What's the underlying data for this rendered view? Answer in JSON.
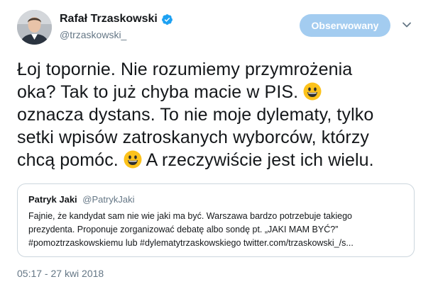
{
  "author": {
    "display_name": "Rafał Trzaskowski",
    "handle": "@trzaskowski_",
    "verified": true
  },
  "follow_button": {
    "label": "Obserwowany"
  },
  "tweet": {
    "line1": "Łoj topornie. Nie rozumiemy przymrożenia",
    "line2": "oka? Tak to już chyba macie w PIS.",
    "line3": "oznacza dystans. To nie moje dylematy, tylko",
    "line4": "setki wpisów zatroskanych wyborców, którzy",
    "line5a": "chcą pomóc.",
    "line5b": "A rzeczywiście jest ich wielu.",
    "emoji_name": "grinning-face-icon"
  },
  "quoted_tweet": {
    "display_name": "Patryk Jaki",
    "handle": "@PatrykJaki",
    "line1": "Fajnie, że kandydat sam nie wie jaki ma być. Warszawa bardzo potrzebuje takiego",
    "line2": "prezydenta. Proponuje zorganizować debatę albo sondę pt. „JAKI MAM BYĆ?”",
    "line3": "#pomoztrzaskowskiemu lub #dylematytrzaskowskiego twitter.com/trzaskowski_/s..."
  },
  "timestamp": "05:17 - 27 kwi 2018",
  "colors": {
    "verified_blue": "#1da1f2",
    "follow_button_bg": "#a3ccf0",
    "secondary_text": "#657786",
    "border": "#ccd6dd"
  }
}
